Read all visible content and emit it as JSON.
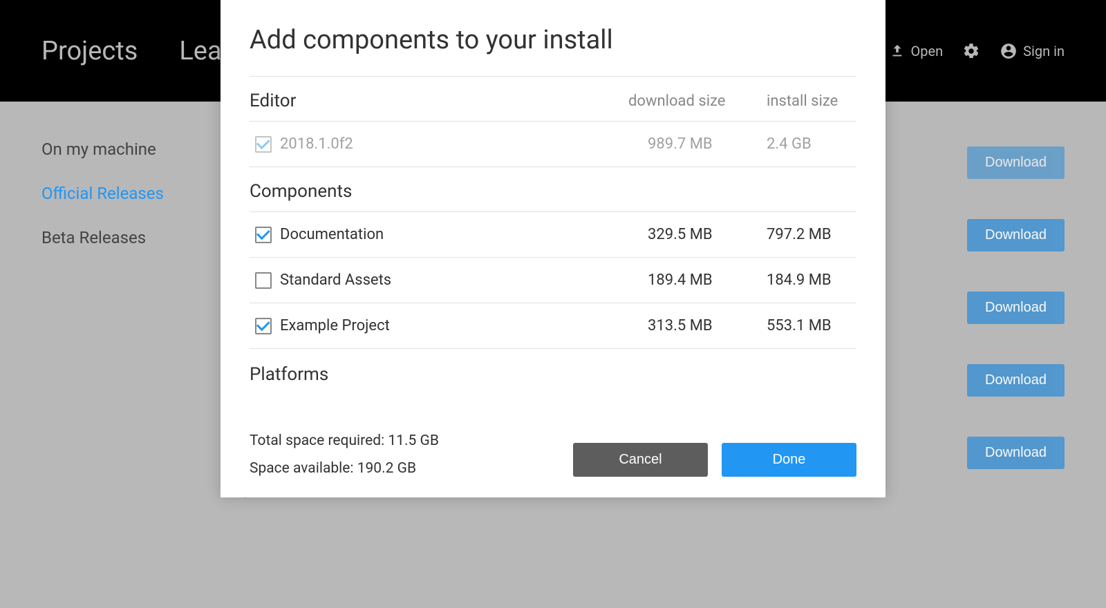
{
  "topbar": {
    "tabs": {
      "projects": "Projects",
      "learn": "Learn"
    },
    "open": "Open",
    "signin": "Sign in"
  },
  "sidebar": {
    "items": [
      {
        "label": "On my machine"
      },
      {
        "label": "Official Releases"
      },
      {
        "label": "Beta Releases"
      }
    ]
  },
  "downloads": {
    "label": "Download"
  },
  "modal": {
    "title": "Add components to your install",
    "editor_section": "Editor",
    "col_download": "download size",
    "col_install": "install size",
    "editor": {
      "name": "2018.1.0f2",
      "download": "989.7 MB",
      "install": "2.4 GB"
    },
    "components_section": "Components",
    "components": [
      {
        "name": "Documentation",
        "download": "329.5 MB",
        "install": "797.2 MB",
        "checked": true
      },
      {
        "name": "Standard Assets",
        "download": "189.4 MB",
        "install": "184.9 MB",
        "checked": false
      },
      {
        "name": "Example Project",
        "download": "313.5 MB",
        "install": "553.1 MB",
        "checked": true
      }
    ],
    "platforms_section": "Platforms",
    "space_required": "Total space required: 11.5 GB",
    "space_available": "Space available: 190.2 GB",
    "cancel": "Cancel",
    "done": "Done"
  }
}
